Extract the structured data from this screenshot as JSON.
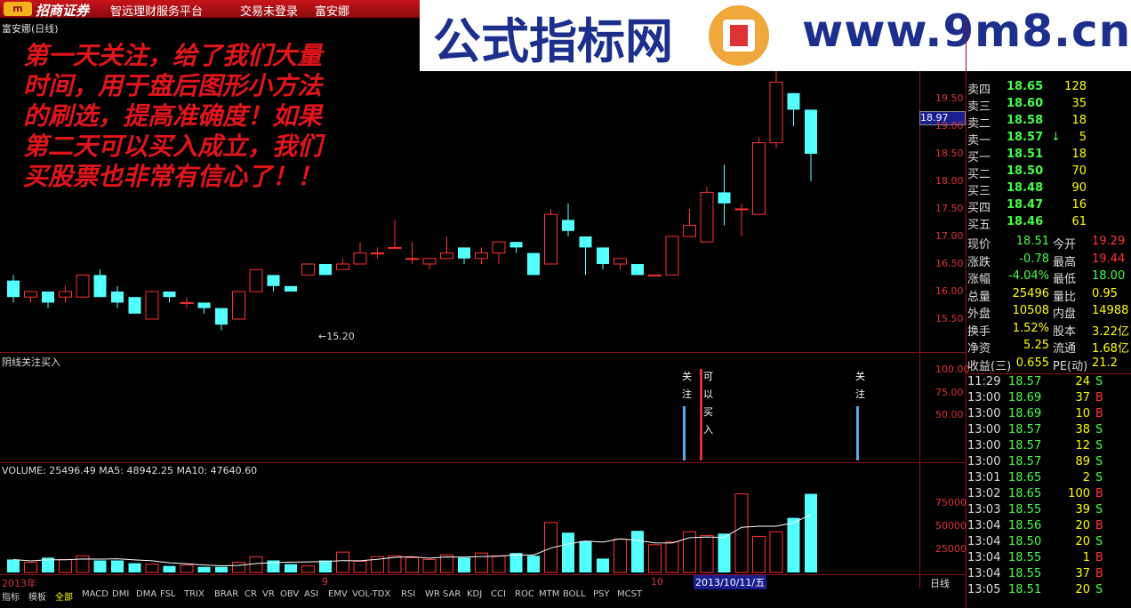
{
  "titlebar": {
    "logo_text": "m",
    "brand": "招商证券",
    "subtitle": "智远理财服务平台",
    "login": "交易未登录",
    "stock": "富安娜"
  },
  "watermark": {
    "cn": "公式指标网",
    "url": "www.9m8.cn"
  },
  "main_chart": {
    "title": "富安娜(日线)",
    "marker": "←15.20",
    "date_labels": [
      "2013年",
      "9",
      "10"
    ],
    "y_ticks": [
      "19.50",
      "19.00",
      "18.50",
      "18.00",
      "17.50",
      "17.00",
      "16.50",
      "16.00",
      "15.50"
    ],
    "price_tag": "18.97",
    "note": "第一天关注，给了我们大量时间，用于盘后图形小方法的刷选，提高准确度！如果第二天可以买入成立，我们买股票也非常有信心了！！"
  },
  "indicator": {
    "title": "阴线关注买入",
    "y_ticks": [
      "100.00",
      "75.00",
      "50.00"
    ],
    "signals": [
      {
        "label": "关注",
        "color": "#5aa9e6"
      },
      {
        "label": "可以买入",
        "color": "#e03030"
      },
      {
        "label": "关注",
        "color": "#5aa9e6"
      }
    ]
  },
  "volume": {
    "title": "VOLUME: 25496.49  MA5: 48942.25  MA10: 47640.60",
    "y_ticks": [
      "75000",
      "50000",
      "25000"
    ],
    "date_tag": "2013/10/11/五",
    "period": "日线"
  },
  "order_book": [
    {
      "label": "卖四",
      "price": "18.65",
      "vol": "128"
    },
    {
      "label": "卖三",
      "price": "18.60",
      "vol": "35"
    },
    {
      "label": "卖二",
      "price": "18.58",
      "vol": "18"
    },
    {
      "label": "卖一",
      "price": "18.57",
      "vol": "5",
      "arrow": "↓"
    },
    {
      "label": "买一",
      "price": "18.51",
      "vol": "18"
    },
    {
      "label": "买二",
      "price": "18.50",
      "vol": "70"
    },
    {
      "label": "买三",
      "price": "18.48",
      "vol": "90"
    },
    {
      "label": "买四",
      "price": "18.47",
      "vol": "16"
    },
    {
      "label": "买五",
      "price": "18.46",
      "vol": "61"
    }
  ],
  "stats": [
    {
      "k1": "现价",
      "v1": "18.51",
      "k2": "今开",
      "v2": "19.29"
    },
    {
      "k1": "涨跌",
      "v1": "-0.78",
      "k2": "最高",
      "v2": "19.44"
    },
    {
      "k1": "涨幅",
      "v1": "-4.04%",
      "k2": "最低",
      "v2": "18.00"
    },
    {
      "k1": "总量",
      "v1": "25496",
      "k2": "量比",
      "v2": "0.95"
    },
    {
      "k1": "外盘",
      "v1": "10508",
      "k2": "内盘",
      "v2": "14988"
    },
    {
      "k1": "换手",
      "v1": "1.52%",
      "k2": "股本",
      "v2": "3.22亿"
    },
    {
      "k1": "净资",
      "v1": "5.25",
      "k2": "流通",
      "v2": "1.68亿"
    },
    {
      "k1": "收益(三)",
      "v1": "0.655",
      "k2": "PE(动)",
      "v2": "21.2"
    }
  ],
  "ticks": [
    {
      "t": "11:29",
      "p": "18.57",
      "v": "24",
      "d": "S"
    },
    {
      "t": "13:00",
      "p": "18.69",
      "v": "37",
      "d": "B"
    },
    {
      "t": "13:00",
      "p": "18.69",
      "v": "10",
      "d": "B"
    },
    {
      "t": "13:00",
      "p": "18.57",
      "v": "38",
      "d": "S"
    },
    {
      "t": "13:00",
      "p": "18.57",
      "v": "12",
      "d": "S"
    },
    {
      "t": "13:00",
      "p": "18.57",
      "v": "89",
      "d": "S"
    },
    {
      "t": "13:01",
      "p": "18.65",
      "v": "2",
      "d": "S"
    },
    {
      "t": "13:02",
      "p": "18.65",
      "v": "100",
      "d": "B"
    },
    {
      "t": "13:03",
      "p": "18.55",
      "v": "39",
      "d": "S"
    },
    {
      "t": "13:04",
      "p": "18.56",
      "v": "20",
      "d": "B"
    },
    {
      "t": "13:04",
      "p": "18.50",
      "v": "20",
      "d": "S"
    },
    {
      "t": "13:04",
      "p": "18.55",
      "v": "1",
      "d": "B"
    },
    {
      "t": "13:04",
      "p": "18.55",
      "v": "37",
      "d": "B"
    },
    {
      "t": "13:05",
      "p": "18.51",
      "v": "20",
      "d": "S"
    }
  ],
  "tabs": [
    "指标",
    "模板",
    "全部",
    "MACD",
    "DMI",
    "DMA",
    "FSL",
    "TRIX",
    "BRAR",
    "CR",
    "VR",
    "OBV",
    "ASI",
    "EMV",
    "VOL-TDX",
    "RSI",
    "WR",
    "SAR",
    "KDJ",
    "CCI",
    "ROC",
    "MTM",
    "BOLL",
    "PSY",
    "MCST"
  ],
  "colors": {
    "up": "#ff3232",
    "down": "#54ffff",
    "grid": "#8a1018",
    "accent": "#1c2f8c"
  },
  "chart_data": {
    "type": "candlestick",
    "y_range": [
      15.0,
      20.0
    ],
    "candles": [
      [
        16.2,
        15.9,
        16.3,
        15.8
      ],
      [
        15.9,
        16.0,
        16.0,
        15.8
      ],
      [
        16.0,
        15.8,
        16.0,
        15.7
      ],
      [
        15.9,
        16.0,
        16.1,
        15.8
      ],
      [
        15.9,
        16.3,
        16.3,
        15.9
      ],
      [
        16.3,
        15.9,
        16.4,
        15.9
      ],
      [
        16.0,
        15.8,
        16.1,
        15.7
      ],
      [
        15.9,
        15.6,
        15.9,
        15.6
      ],
      [
        15.5,
        16.0,
        16.0,
        15.5
      ],
      [
        16.0,
        15.9,
        16.0,
        15.8
      ],
      [
        15.8,
        15.8,
        15.9,
        15.7
      ],
      [
        15.8,
        15.7,
        15.8,
        15.6
      ],
      [
        15.7,
        15.4,
        15.7,
        15.3
      ],
      [
        15.5,
        16.0,
        16.0,
        15.5
      ],
      [
        16.0,
        16.4,
        16.4,
        16.0
      ],
      [
        16.3,
        16.1,
        16.3,
        16.0
      ],
      [
        16.1,
        16.0,
        16.1,
        16.0
      ],
      [
        16.3,
        16.5,
        16.5,
        16.3
      ],
      [
        16.5,
        16.3,
        16.5,
        16.3
      ],
      [
        16.4,
        16.5,
        16.6,
        16.4
      ],
      [
        16.5,
        16.7,
        16.9,
        16.5
      ],
      [
        16.7,
        16.7,
        16.8,
        16.6
      ],
      [
        16.8,
        16.8,
        17.3,
        16.8
      ],
      [
        16.6,
        16.6,
        16.9,
        16.5
      ],
      [
        16.5,
        16.6,
        16.6,
        16.4
      ],
      [
        16.6,
        16.7,
        17.0,
        16.6
      ],
      [
        16.8,
        16.6,
        16.8,
        16.5
      ],
      [
        16.6,
        16.7,
        16.8,
        16.5
      ],
      [
        16.7,
        16.9,
        16.9,
        16.5
      ],
      [
        16.9,
        16.8,
        16.9,
        16.7
      ],
      [
        16.7,
        16.3,
        16.7,
        16.3
      ],
      [
        16.5,
        17.4,
        17.5,
        16.5
      ],
      [
        17.3,
        17.1,
        17.6,
        17.0
      ],
      [
        17.0,
        16.8,
        16.9,
        16.3
      ],
      [
        16.8,
        16.5,
        16.8,
        16.4
      ],
      [
        16.5,
        16.6,
        16.6,
        16.4
      ],
      [
        16.5,
        16.3,
        16.5,
        16.3
      ],
      [
        16.3,
        16.3,
        16.3,
        16.3
      ],
      [
        16.3,
        17.0,
        17.0,
        16.3
      ],
      [
        17.0,
        17.2,
        17.5,
        17.0
      ],
      [
        16.9,
        17.8,
        17.9,
        16.9
      ],
      [
        17.8,
        17.6,
        18.3,
        17.2
      ],
      [
        17.5,
        17.5,
        17.6,
        17.0
      ],
      [
        17.4,
        18.7,
        18.8,
        17.4
      ],
      [
        18.7,
        19.8,
        20.0,
        18.6
      ],
      [
        19.6,
        19.3,
        19.6,
        19.0
      ],
      [
        19.3,
        18.5,
        19.3,
        18.0
      ]
    ],
    "volume": [
      14000,
      11000,
      16000,
      14000,
      18000,
      13000,
      13000,
      10000,
      9000,
      7000,
      8000,
      6000,
      6000,
      11000,
      17000,
      13000,
      9000,
      7000,
      13000,
      22000,
      12000,
      17000,
      18000,
      16000,
      14000,
      19000,
      16000,
      21000,
      18000,
      21000,
      18000,
      54000,
      43000,
      34000,
      15000,
      36000,
      45000,
      30000,
      33000,
      44000,
      40000,
      42000,
      85000,
      39000,
      44000,
      59000,
      85000,
      40000,
      25000
    ]
  }
}
